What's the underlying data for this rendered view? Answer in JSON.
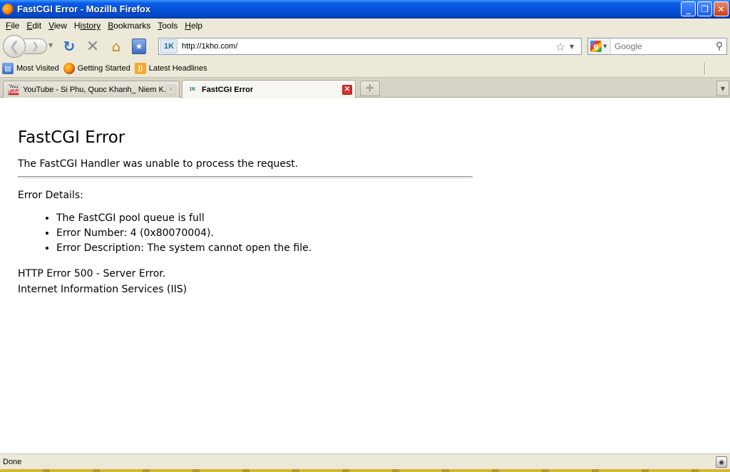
{
  "window": {
    "title": "FastCGI Error - Mozilla Firefox",
    "buttons": {
      "minimize": "_",
      "maximize": "❐",
      "close": "✕"
    }
  },
  "menu": {
    "items": [
      {
        "label": "File",
        "accel": "F",
        "rest": "ile"
      },
      {
        "label": "Edit",
        "accel": "E",
        "rest": "dit"
      },
      {
        "label": "View",
        "accel": "V",
        "rest": "iew"
      },
      {
        "label": "History",
        "accel": "H",
        "rest": "istory",
        "pre": ""
      },
      {
        "label": "Bookmarks",
        "accel": "B",
        "rest": "ookmarks"
      },
      {
        "label": "Tools",
        "accel": "T",
        "rest": "ools"
      },
      {
        "label": "Help",
        "accel": "H",
        "rest": "elp"
      }
    ]
  },
  "nav": {
    "url": "http://1kho.com/",
    "site_icon_text": "1K",
    "search_placeholder": "Google",
    "search_engine_letter": "g"
  },
  "bookmarks": [
    {
      "label": "Most Visited",
      "icon": "most-visited-icon"
    },
    {
      "label": "Getting Started",
      "icon": "firefox-icon"
    },
    {
      "label": "Latest Headlines",
      "icon": "rss-icon"
    }
  ],
  "tabs": [
    {
      "label": "YouTube - Si Phu, Quoc Khanh_ Niem K...",
      "favicon": "youtube-favicon",
      "favicon_text_top": "You",
      "favicon_text_bottom": "Tube",
      "active": false
    },
    {
      "label": "FastCGI Error",
      "favicon": "1k-favicon",
      "favicon_text": "1K",
      "active": true
    }
  ],
  "content": {
    "heading": "FastCGI Error",
    "lead": "The FastCGI Handler was unable to process the request.",
    "details_heading": "Error Details:",
    "details": [
      "The FastCGI pool queue is full",
      "Error Number: 4 (0x80070004).",
      "Error Description: The system cannot open the file."
    ],
    "footer_line1": "HTTP Error 500 - Server Error.",
    "footer_line2": "Internet Information Services (IIS)"
  },
  "status": {
    "text": "Done"
  },
  "colors": {
    "titlebar": "#0553dc",
    "chrome": "#ece9d8",
    "close_tab": "#d4322b"
  }
}
